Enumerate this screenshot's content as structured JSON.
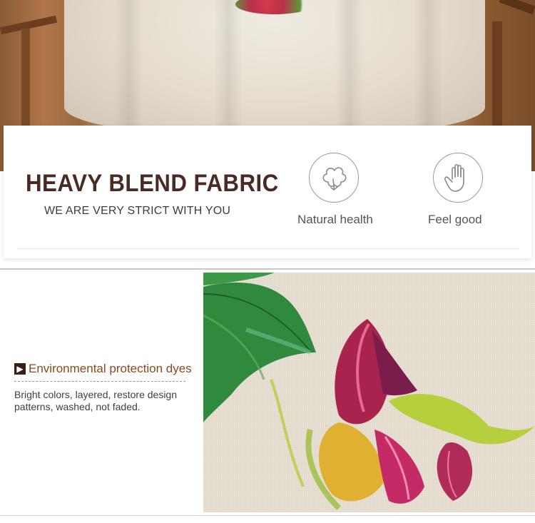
{
  "banner": {
    "headline": "HEAVY BLEND FABRIC",
    "tagline": "WE ARE VERY STRICT WITH YOU",
    "features": [
      {
        "label": "Natural health",
        "icon": "cotton-icon"
      },
      {
        "label": "Feel good",
        "icon": "hand-icon"
      }
    ]
  },
  "detail": {
    "title": "Environmental protection dyes",
    "arrow": "▶",
    "description": "Bright colors, layered, restore design patterns, washed, not faded."
  },
  "colors": {
    "headline": "#4a2a22",
    "title_accent": "#8a4a1c",
    "fabric": "#e8e0d2",
    "leaf_green": "#2f8a3e",
    "petal_magenta": "#a8234e",
    "petal_yellow": "#e0b032"
  }
}
